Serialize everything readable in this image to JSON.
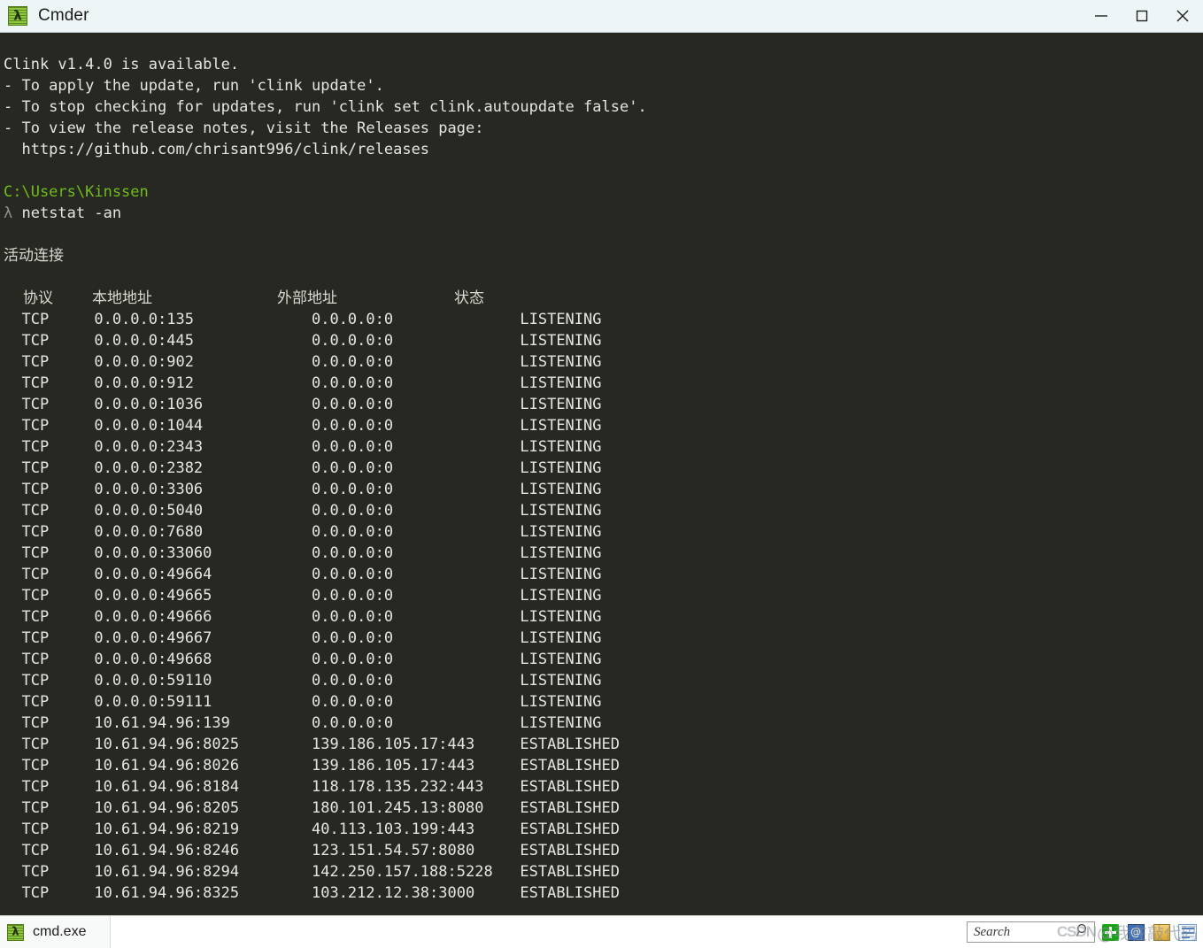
{
  "window": {
    "title": "Cmder",
    "app_icon": "lambda-icon",
    "buttons": {
      "minimize": "minimize-icon",
      "maximize": "maximize-icon",
      "close": "close-icon"
    }
  },
  "terminal": {
    "colors": {
      "background": "#272822",
      "foreground": "#e6e6e1",
      "prompt_path": "#6fbd1a",
      "dim": "#8f9088"
    },
    "banner": [
      "Clink v1.4.0 is available.",
      "- To apply the update, run 'clink update'.",
      "- To stop checking for updates, run 'clink set clink.autoupdate false'.",
      "- To view the release notes, visit the Releases page:",
      "  https://github.com/chrisant996/clink/releases"
    ],
    "prompt_path": "C:\\Users\\Kinssen",
    "prompt_symbol": "λ",
    "command": "netstat -an",
    "output_title": "活动连接",
    "columns": [
      "协议",
      "本地地址",
      "外部地址",
      "状态"
    ],
    "rows": [
      [
        "TCP",
        "0.0.0.0:135",
        "0.0.0.0:0",
        "LISTENING"
      ],
      [
        "TCP",
        "0.0.0.0:445",
        "0.0.0.0:0",
        "LISTENING"
      ],
      [
        "TCP",
        "0.0.0.0:902",
        "0.0.0.0:0",
        "LISTENING"
      ],
      [
        "TCP",
        "0.0.0.0:912",
        "0.0.0.0:0",
        "LISTENING"
      ],
      [
        "TCP",
        "0.0.0.0:1036",
        "0.0.0.0:0",
        "LISTENING"
      ],
      [
        "TCP",
        "0.0.0.0:1044",
        "0.0.0.0:0",
        "LISTENING"
      ],
      [
        "TCP",
        "0.0.0.0:2343",
        "0.0.0.0:0",
        "LISTENING"
      ],
      [
        "TCP",
        "0.0.0.0:2382",
        "0.0.0.0:0",
        "LISTENING"
      ],
      [
        "TCP",
        "0.0.0.0:3306",
        "0.0.0.0:0",
        "LISTENING"
      ],
      [
        "TCP",
        "0.0.0.0:5040",
        "0.0.0.0:0",
        "LISTENING"
      ],
      [
        "TCP",
        "0.0.0.0:7680",
        "0.0.0.0:0",
        "LISTENING"
      ],
      [
        "TCP",
        "0.0.0.0:33060",
        "0.0.0.0:0",
        "LISTENING"
      ],
      [
        "TCP",
        "0.0.0.0:49664",
        "0.0.0.0:0",
        "LISTENING"
      ],
      [
        "TCP",
        "0.0.0.0:49665",
        "0.0.0.0:0",
        "LISTENING"
      ],
      [
        "TCP",
        "0.0.0.0:49666",
        "0.0.0.0:0",
        "LISTENING"
      ],
      [
        "TCP",
        "0.0.0.0:49667",
        "0.0.0.0:0",
        "LISTENING"
      ],
      [
        "TCP",
        "0.0.0.0:49668",
        "0.0.0.0:0",
        "LISTENING"
      ],
      [
        "TCP",
        "0.0.0.0:59110",
        "0.0.0.0:0",
        "LISTENING"
      ],
      [
        "TCP",
        "0.0.0.0:59111",
        "0.0.0.0:0",
        "LISTENING"
      ],
      [
        "TCP",
        "10.61.94.96:139",
        "0.0.0.0:0",
        "LISTENING"
      ],
      [
        "TCP",
        "10.61.94.96:8025",
        "139.186.105.17:443",
        "ESTABLISHED"
      ],
      [
        "TCP",
        "10.61.94.96:8026",
        "139.186.105.17:443",
        "ESTABLISHED"
      ],
      [
        "TCP",
        "10.61.94.96:8184",
        "118.178.135.232:443",
        "ESTABLISHED"
      ],
      [
        "TCP",
        "10.61.94.96:8205",
        "180.101.245.13:8080",
        "ESTABLISHED"
      ],
      [
        "TCP",
        "10.61.94.96:8219",
        "40.113.103.199:443",
        "ESTABLISHED"
      ],
      [
        "TCP",
        "10.61.94.96:8246",
        "123.151.54.57:8080",
        "ESTABLISHED"
      ],
      [
        "TCP",
        "10.61.94.96:8294",
        "142.250.157.188:5228",
        "ESTABLISHED"
      ],
      [
        "TCP",
        "10.61.94.96:8325",
        "103.212.12.38:3000",
        "ESTABLISHED"
      ]
    ]
  },
  "statusbar": {
    "tab_label": "cmd.exe",
    "tab_icon": "lambda-icon",
    "search_placeholder": "Search",
    "search_value": "",
    "search_icon": "magnifier-icon",
    "toolbar_icons": [
      "new-console-icon",
      "at-icon",
      "settings-icon",
      "panel-icon"
    ]
  },
  "watermark": {
    "brand": "CSDN",
    "handle": "@我在敲代码"
  }
}
